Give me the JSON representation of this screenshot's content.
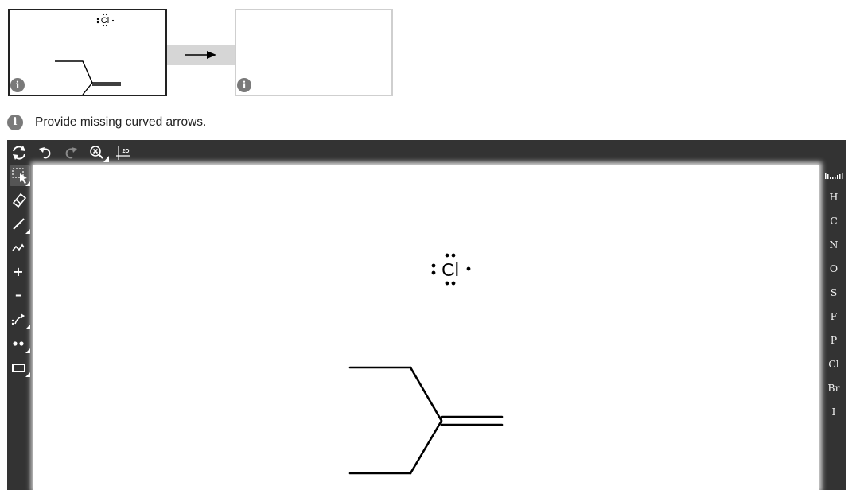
{
  "reaction": {
    "reactant_chlorine_label": "Cl",
    "product_empty": true,
    "reactant_info_icon": "info-icon",
    "product_info_icon": "info-icon"
  },
  "instructions": {
    "text": "Provide missing curved arrows.",
    "icon": "info-icon"
  },
  "toolbar": {
    "items": [
      "refresh-icon",
      "undo-icon",
      "redo-icon",
      "zoom-clear-icon",
      "2d-icon"
    ],
    "label_2d": "2D"
  },
  "left_tools": [
    "select-tool-icon",
    "eraser-icon",
    "bond-tool-icon",
    "chain-tool-icon",
    "positive-charge-icon",
    "negative-charge-icon",
    "curved-arrow-icon",
    "lone-pair-icon",
    "ring-tool-icon"
  ],
  "charges": {
    "plus": "+",
    "minus": "–"
  },
  "elements": [
    "H",
    "C",
    "N",
    "O",
    "S",
    "F",
    "P",
    "Cl",
    "Br",
    "I"
  ],
  "canvas": {
    "chlorine_label": "Cl"
  }
}
